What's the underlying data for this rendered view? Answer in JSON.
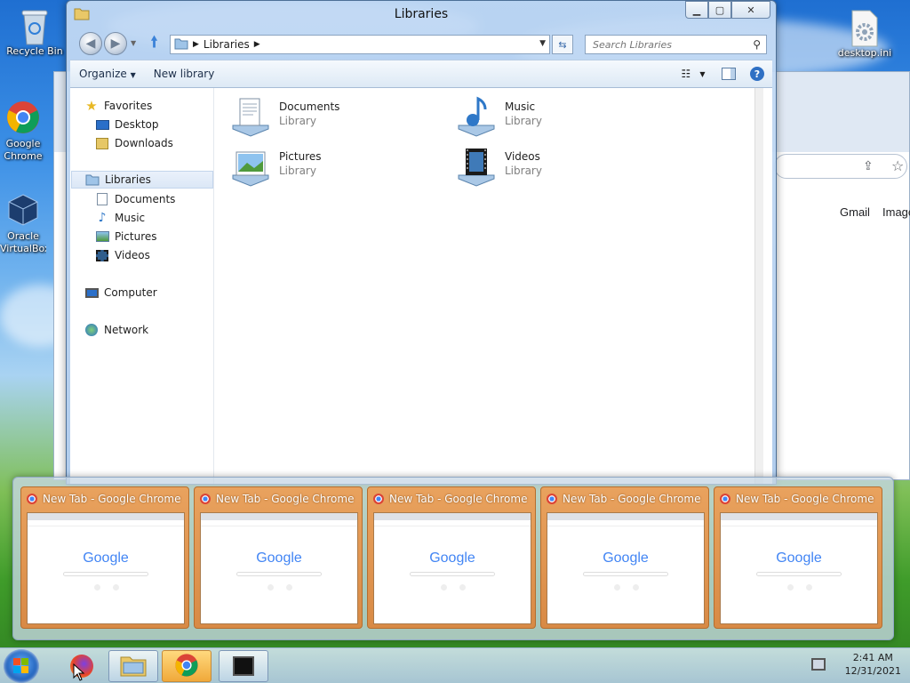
{
  "desktop": {
    "icons": [
      {
        "label": "Recycle Bin",
        "icon": "recycle-bin-icon"
      },
      {
        "label": "Google Chrome",
        "icon": "chrome-icon"
      },
      {
        "label": "Oracle VirtualBox",
        "icon": "virtualbox-icon"
      },
      {
        "label": "desktop.ini",
        "icon": "settings-file-icon"
      }
    ]
  },
  "bg_chrome": {
    "gmail": "Gmail",
    "images": "Images"
  },
  "explorer": {
    "title": "Libraries",
    "address": {
      "crumb": "Libraries"
    },
    "search_placeholder": "Search Libraries",
    "toolbar": {
      "organize": "Organize",
      "new_library": "New library"
    },
    "nav": {
      "favorites": "Favorites",
      "desktop": "Desktop",
      "downloads": "Downloads",
      "libraries": "Libraries",
      "documents": "Documents",
      "music": "Music",
      "pictures": "Pictures",
      "videos": "Videos",
      "computer": "Computer",
      "network": "Network"
    },
    "libraries": [
      {
        "name": "Documents",
        "type": "Library"
      },
      {
        "name": "Music",
        "type": "Library"
      },
      {
        "name": "Pictures",
        "type": "Library"
      },
      {
        "name": "Videos",
        "type": "Library"
      }
    ]
  },
  "thumbnails": [
    {
      "title": "New Tab - Google Chrome",
      "logo": "Google"
    },
    {
      "title": "New Tab - Google Chrome",
      "logo": "Google"
    },
    {
      "title": "New Tab - Google Chrome",
      "logo": "Google"
    },
    {
      "title": "New Tab - Google Chrome",
      "logo": "Google"
    },
    {
      "title": "New Tab - Google Chrome",
      "logo": "Google"
    }
  ],
  "taskbar": {
    "time": "2:41 AM",
    "date": "12/31/2021"
  },
  "colors": {
    "thumb_bg": "#e39a55",
    "accent": "#3567a8"
  }
}
